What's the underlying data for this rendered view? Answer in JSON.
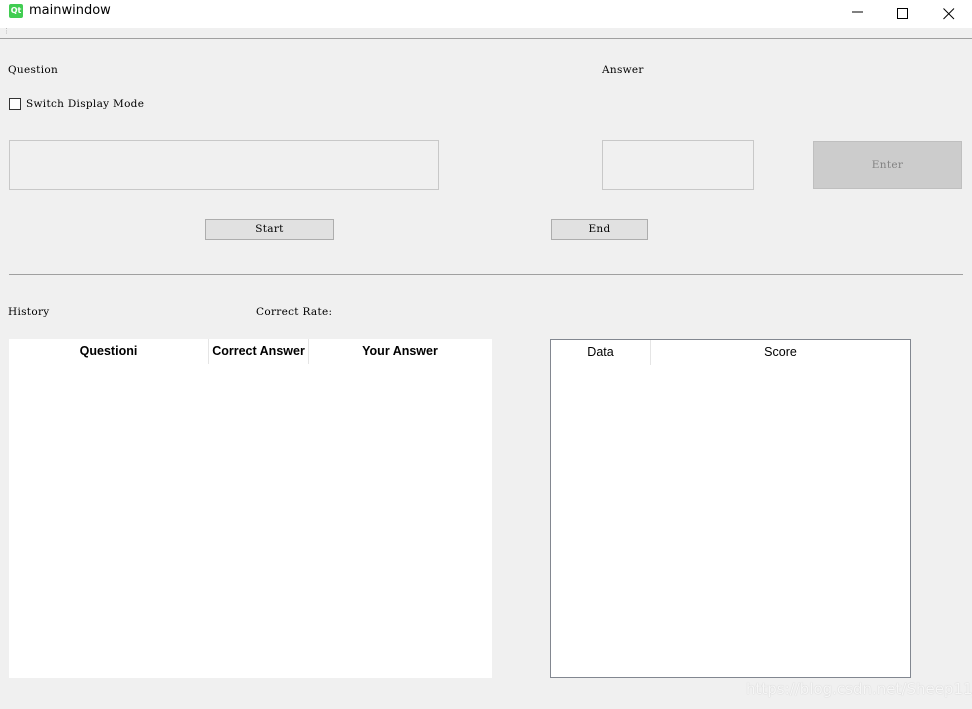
{
  "window": {
    "icon_text": "Qt",
    "title": "mainwindow"
  },
  "form": {
    "question_label": "Question",
    "answer_label": "Answer",
    "switch_display_mode_label": "Switch Display Mode",
    "switch_display_mode_checked": false,
    "question_text": "",
    "answer_value": "",
    "enter_label": "Enter",
    "start_label": "Start",
    "end_label": "End"
  },
  "history": {
    "label": "History",
    "correct_rate_label": "Correct Rate:",
    "columns": [
      "Questioni",
      "Correct Answer",
      "Your Answer"
    ],
    "rows": []
  },
  "scores": {
    "columns": [
      "Data",
      "Score"
    ],
    "rows": []
  },
  "watermark": "https://blog.csdn.net/Sheep11_",
  "colors": {
    "qt_green": "#41cd52",
    "window_bg": "#f0f0f0",
    "disabled_button": "#cccccc"
  }
}
